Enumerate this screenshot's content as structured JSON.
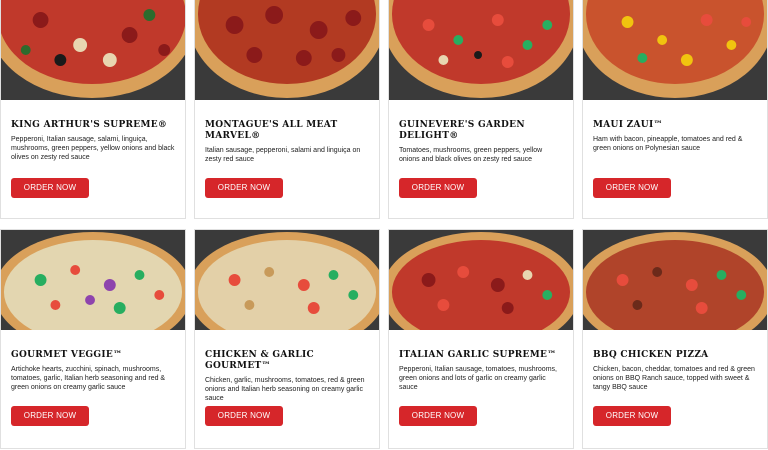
{
  "menu": {
    "order_label": "ORDER NOW",
    "items": [
      {
        "name": "KING ARTHUR'S SUPREME®",
        "description": "Pepperoni, Italian sausage, salami, linguiça, mushrooms, green peppers, yellow onions and black olives on zesty red sauce"
      },
      {
        "name": "MONTAGUE'S ALL MEAT MARVEL®",
        "description": "Italian sausage, pepperoni, salami and linguiça on zesty red sauce"
      },
      {
        "name": "GUINEVERE'S GARDEN DELIGHT®",
        "description": "Tomatoes, mushrooms, green peppers, yellow onions and black olives on zesty red sauce"
      },
      {
        "name": "MAUI ZAUI™",
        "description": "Ham with bacon, pineapple, tomatoes and red & green onions on Polynesian sauce"
      },
      {
        "name": "GOURMET VEGGIE™",
        "description": "Artichoke hearts, zucchini, spinach, mushrooms, tomatoes, garlic, Italian herb seasoning and red & green onions on creamy garlic sauce"
      },
      {
        "name": "CHICKEN & GARLIC GOURMET™",
        "description": "Chicken, garlic, mushrooms, tomatoes, red & green onions and Italian herb seasoning on creamy garlic sauce"
      },
      {
        "name": "ITALIAN GARLIC SUPREME™",
        "description": "Pepperoni, Italian sausage, tomatoes, mushrooms, green onions and lots of garlic on creamy garlic sauce"
      },
      {
        "name": "BBQ CHICKEN PIZZA",
        "description": "Chicken, bacon, cheddar, tomatoes and red & green onions on BBQ Ranch sauce, topped with sweet & tangy BBQ sauce"
      }
    ]
  },
  "colors": {
    "button": "#d6262a",
    "card_border": "#e0e0e0"
  }
}
